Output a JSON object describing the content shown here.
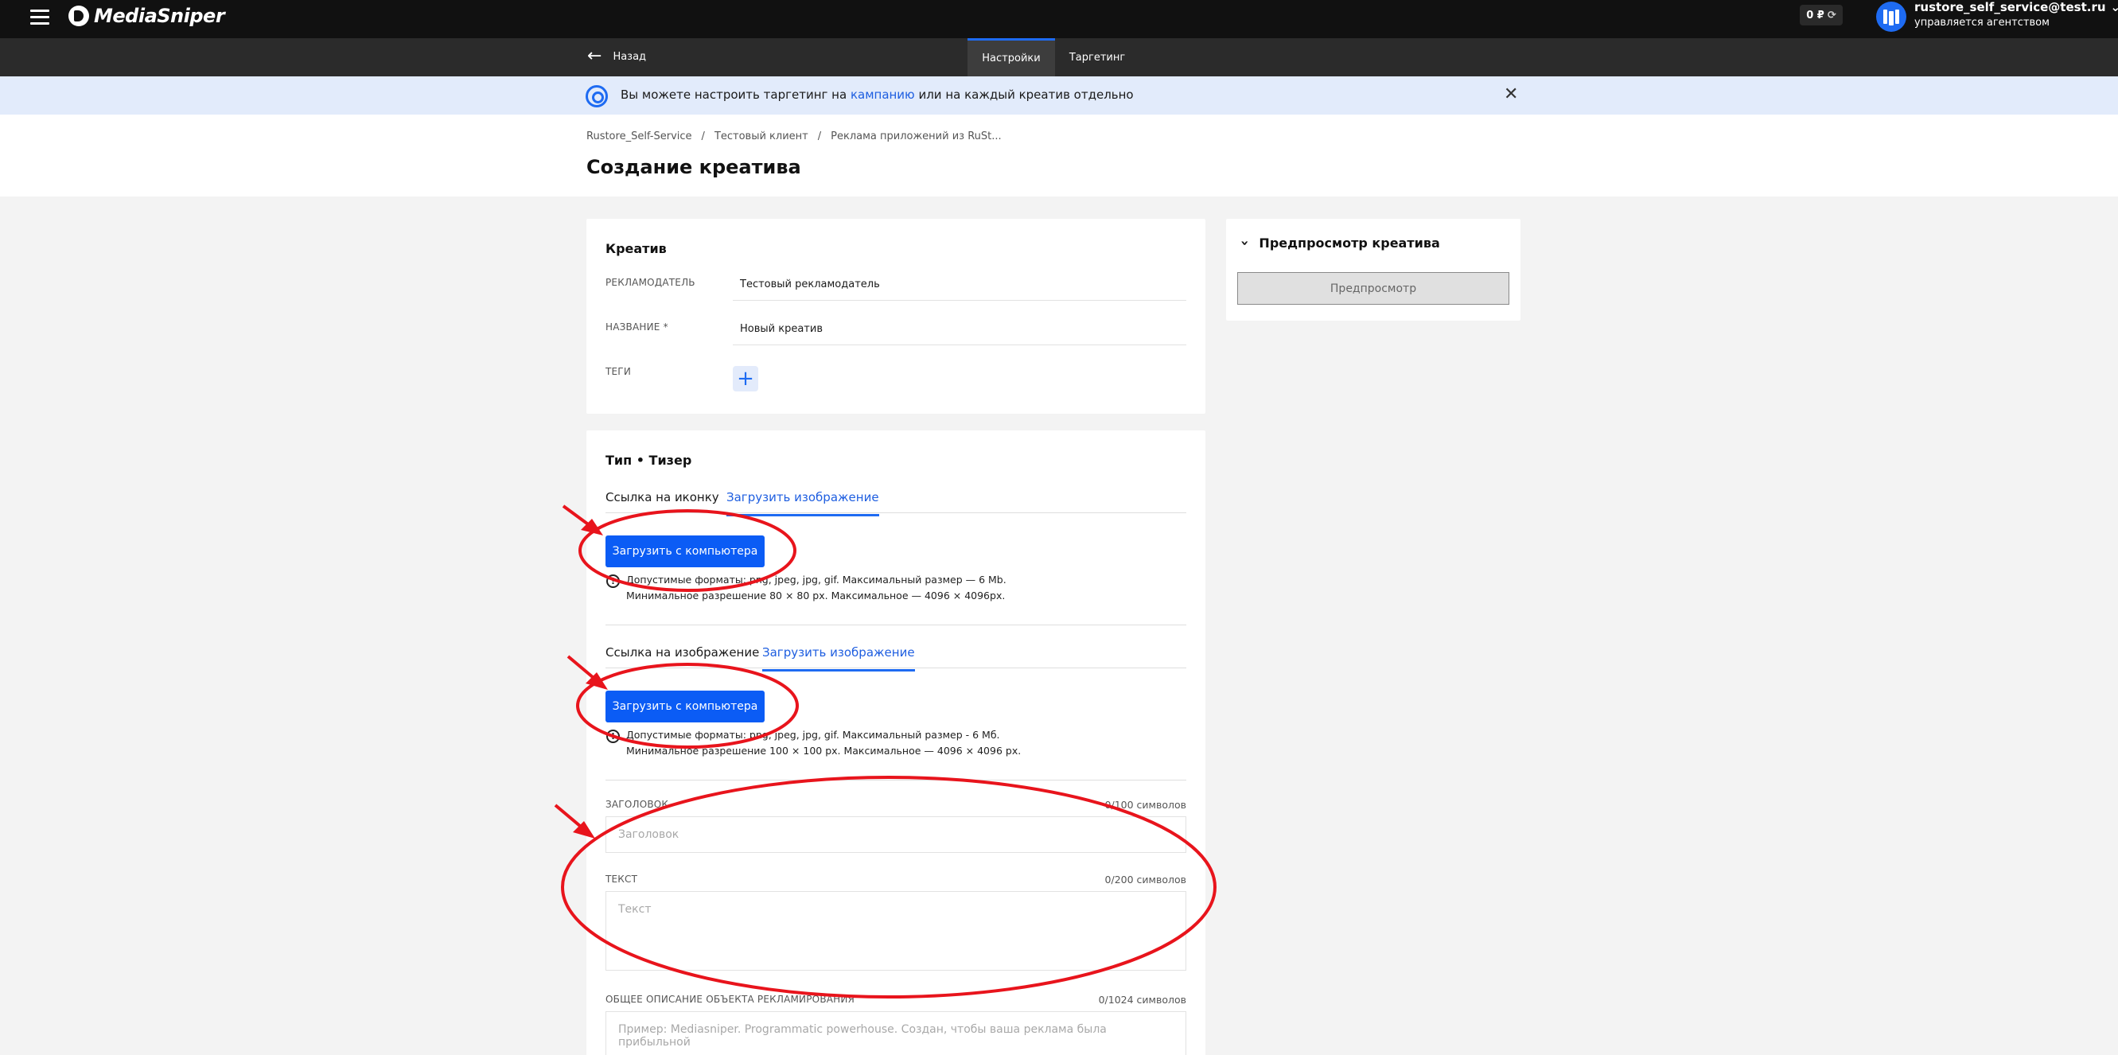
{
  "topbar": {
    "logo_text": "MediaSniper",
    "balance": "0 ₽",
    "user_email": "rustore_self_service@test.ru",
    "user_sub": "управляется агентством"
  },
  "subbar": {
    "back_label": "Назад",
    "tabs": [
      {
        "label": "Настройки",
        "active": true
      },
      {
        "label": "Таргетинг",
        "active": false
      }
    ]
  },
  "info": {
    "text_before": "Вы можете настроить таргетинг на",
    "link": "кампанию",
    "text_after": "или на каждый креатив отдельно"
  },
  "breadcrumbs": [
    "Rustore_Self-Service",
    "Тестовый клиент",
    "Реклама приложений из RuSt..."
  ],
  "page_title": "Создание креатива",
  "creative": {
    "title": "Креатив",
    "advertiser_label": "РЕКЛАМОДАТЕЛЬ",
    "advertiser_value": "Тестовый рекламодатель",
    "name_label": "НАЗВАНИЕ *",
    "name_value": "Новый креатив",
    "tags_label": "ТЕГИ"
  },
  "type": {
    "title": "Тип • Тизер",
    "icon_tabs": [
      {
        "label": "Ссылка на иконку",
        "active": false
      },
      {
        "label": "Загрузить изображение",
        "active": true
      }
    ],
    "upload_button": "Загрузить с компьютера",
    "icon_note_line1": "Допустимые форматы: png, jpeg, jpg, gif. Максимальный размер — 6 Mb.",
    "icon_note_line2": "Минимальное разрешение 80 × 80 px. Максимальное — 4096 × 4096px.",
    "image_tabs": [
      {
        "label": "Ссылка на изображение",
        "active": false
      },
      {
        "label": "Загрузить изображение",
        "active": true
      }
    ],
    "upload_button_2": "Загрузить с компьютера",
    "image_note_line1": "Допустимые форматы: png, jpeg, jpg, gif. Максимальный размер - 6 Мб.",
    "image_note_line2": "Минимальное разрешение 100 × 100 px. Максимальное — 4096 × 4096 px.",
    "headline_label": "ЗАГОЛОВОК",
    "headline_counter": "0/100 символов",
    "headline_placeholder": "Заголовок",
    "text_label": "ТЕКСТ",
    "text_counter": "0/200 символов",
    "text_placeholder": "Текст",
    "desc_label": "ОБЩЕЕ ОПИСАНИЕ ОБЪЕКТА РЕКЛАМИРОВАНИЯ",
    "desc_counter": "0/1024 символов",
    "desc_placeholder": "Пример: Mediasniper. Programmatic powerhouse. Создан, чтобы ваша реклама была прибыльной"
  },
  "preview": {
    "title": "Предпросмотр креатива",
    "button": "Предпросмотр"
  },
  "colors": {
    "accent": "#1e6bf2",
    "annotation": "#e8141c"
  }
}
